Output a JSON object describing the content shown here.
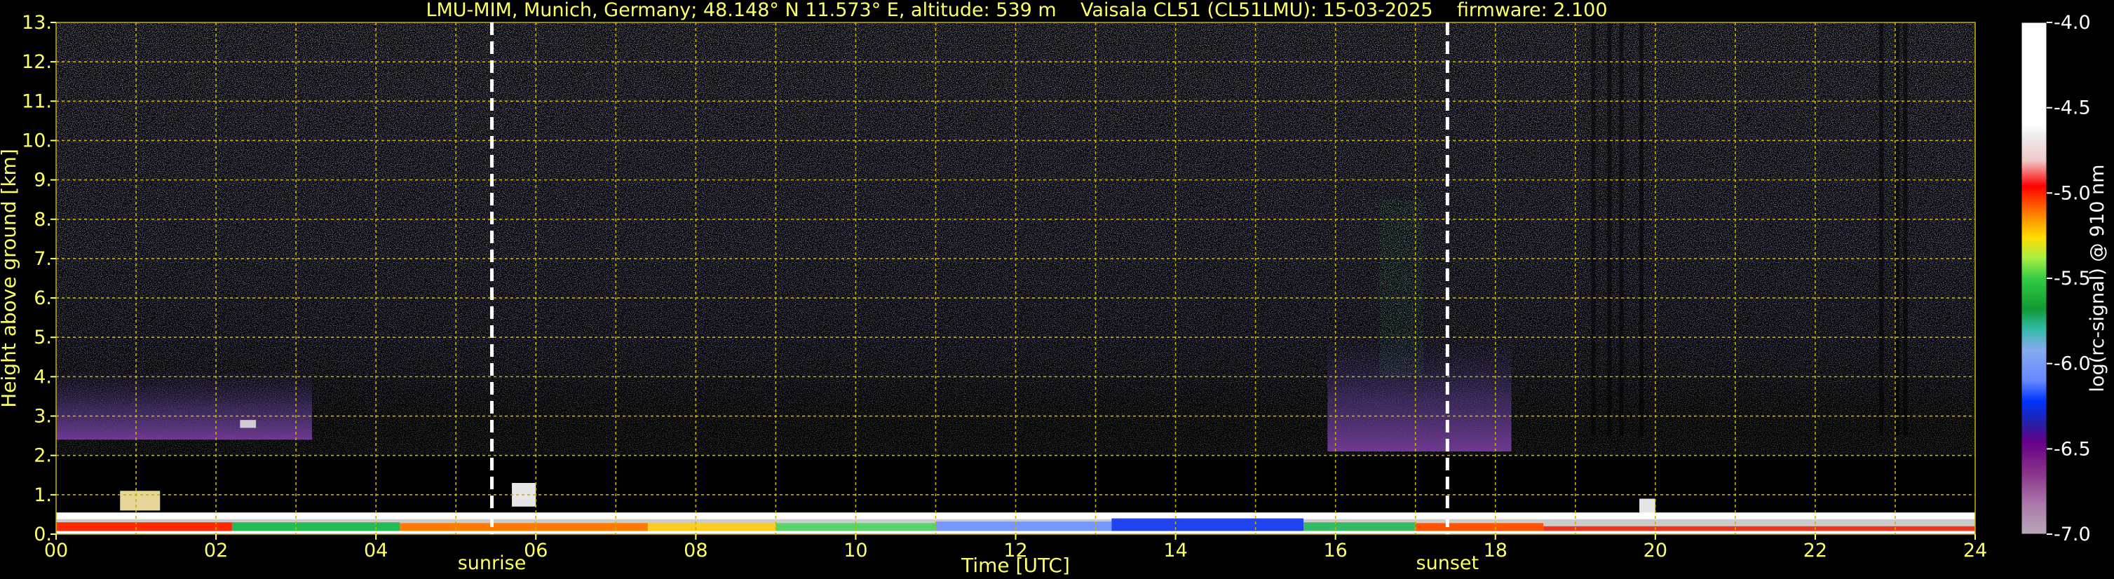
{
  "title": "LMU-MIM, Munich, Germany; 48.148° N 11.573° E, altitude: 539 m    Vaisala CL51 (CL51LMU): 15-03-2025    firmware: 2.100",
  "colors": {
    "background": "#000000",
    "text": "#ffff66",
    "grid": "#c8b400",
    "colorbar_label": "#ffffff",
    "markers": "#ffffff"
  },
  "chart_data": {
    "type": "heatmap",
    "xlabel": "Time [UTC]",
    "ylabel": "Height above ground [km]",
    "xlim": [
      0,
      24
    ],
    "ylim": [
      0,
      13
    ],
    "grid": true,
    "x_ticks": [
      "00",
      "02",
      "04",
      "06",
      "08",
      "10",
      "12",
      "14",
      "16",
      "18",
      "20",
      "22",
      "24"
    ],
    "y_ticks": [
      "0.",
      "1.",
      "2.",
      "3.",
      "4.",
      "5.",
      "6.",
      "7.",
      "8.",
      "9.",
      "10.",
      "11.",
      "12.",
      "13."
    ],
    "markers": [
      {
        "label": "sunrise",
        "x": 5.45
      },
      {
        "label": "sunset",
        "x": 17.4
      }
    ],
    "colorbar": {
      "label": "log(rc-signal) @ 910 nm",
      "range": [
        -7.0,
        -4.0
      ],
      "ticks": [
        "-4.0",
        "-4.5",
        "-5.0",
        "-5.5",
        "-6.0",
        "-6.5",
        "-7.0"
      ]
    }
  }
}
